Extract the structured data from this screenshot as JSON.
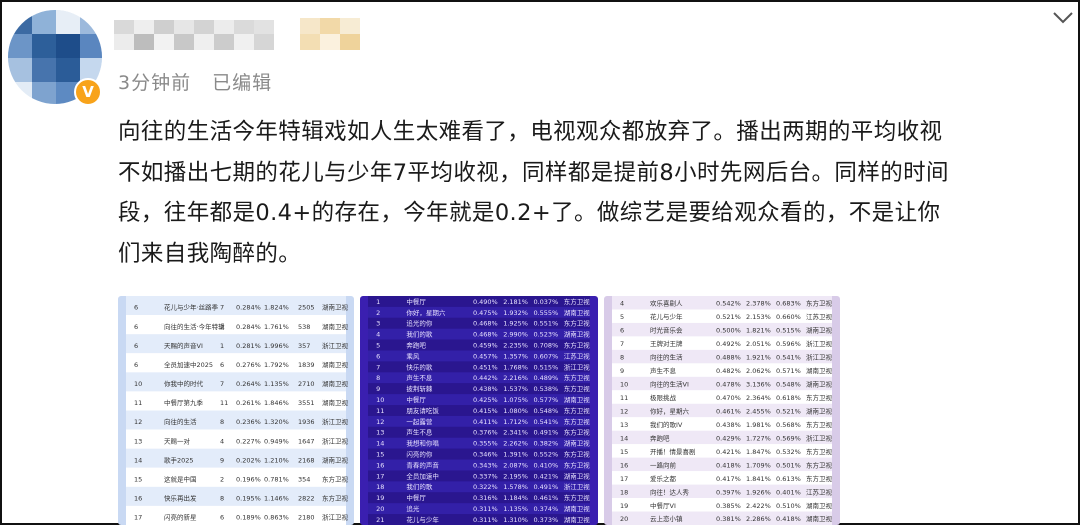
{
  "post": {
    "meta_time": "3分钟前",
    "meta_edited": "已编辑",
    "verified_badge": "V",
    "text_lines": [
      "向往的生活今年特辑戏如人生太难看了，电视观众都放弃了。播出两期的平均收视",
      "不如播出七期的花儿与少年7平均收视，同样都是提前8小时先网后台。同样的时间",
      "段，往年都是0.4+的存在，今年就是0.2+了。做综艺是要给观众看的，不是让你",
      "们来自我陶醉的。"
    ]
  },
  "icons": {
    "avatar": "avatar-image-blurred",
    "verified": "verified-badge-icon",
    "expand": "chevron-down-icon"
  },
  "images": [
    {
      "name": "ratings-table-1",
      "theme": "#c9d9f3",
      "rows": [
        [
          "6",
          "花儿与少年·丝路季",
          "7",
          "0.284%",
          "1.824%",
          "2505",
          "湖南卫视"
        ],
        [
          "6",
          "向往的生活·今年特辑",
          "2",
          "0.284%",
          "1.761%",
          "538",
          "湖南卫视"
        ],
        [
          "6",
          "天赐的声音VI",
          "1",
          "0.281%",
          "1.996%",
          "357",
          "浙江卫视"
        ],
        [
          "6",
          "全员加速中2025",
          "6",
          "0.276%",
          "1.792%",
          "1839",
          "湖南卫视"
        ],
        [
          "10",
          "你我中的时代",
          "7",
          "0.264%",
          "1.135%",
          "2710",
          "湖南卫视"
        ],
        [
          "11",
          "中餐厅第九季",
          "11",
          "0.261%",
          "1.846%",
          "3551",
          "湖南卫视"
        ],
        [
          "12",
          "向往的生活",
          "8",
          "0.236%",
          "1.320%",
          "1936",
          "浙江卫视"
        ],
        [
          "13",
          "天赐一对",
          "4",
          "0.227%",
          "0.949%",
          "1647",
          "浙江卫视"
        ],
        [
          "14",
          "歌手2025",
          "9",
          "0.202%",
          "1.210%",
          "2168",
          "湖南卫视"
        ],
        [
          "15",
          "这就是中国",
          "2",
          "0.196%",
          "0.781%",
          "354",
          "东方卫视"
        ],
        [
          "16",
          "快乐再出发",
          "8",
          "0.195%",
          "1.146%",
          "2822",
          "东方卫视"
        ],
        [
          "17",
          "闪亮的新星",
          "6",
          "0.189%",
          "0.863%",
          "2180",
          "浙江卫视"
        ]
      ]
    },
    {
      "name": "ratings-table-2",
      "theme": "#3a1fb0",
      "rows": [
        [
          "1",
          "中餐厅",
          "0.490%",
          "2.181%",
          "0.037%",
          "东方卫视"
        ],
        [
          "2",
          "你好，星期六",
          "0.475%",
          "1.932%",
          "0.555%",
          "湖南卫视"
        ],
        [
          "3",
          "追光的你",
          "0.468%",
          "1.925%",
          "0.551%",
          "东方卫视"
        ],
        [
          "4",
          "我们的歌",
          "0.468%",
          "2.990%",
          "0.523%",
          "湖南卫视"
        ],
        [
          "5",
          "奔跑吧",
          "0.459%",
          "2.235%",
          "0.708%",
          "东方卫视"
        ],
        [
          "6",
          "乘风",
          "0.457%",
          "1.357%",
          "0.607%",
          "江苏卫视"
        ],
        [
          "7",
          "快乐的歌",
          "0.451%",
          "1.768%",
          "0.515%",
          "浙江卫视"
        ],
        [
          "8",
          "声生不息",
          "0.442%",
          "2.216%",
          "0.489%",
          "东方卫视"
        ],
        [
          "9",
          "披荆斩棘",
          "0.438%",
          "1.537%",
          "0.538%",
          "东方卫视"
        ],
        [
          "10",
          "中餐厅",
          "0.425%",
          "1.075%",
          "0.577%",
          "湖南卫视"
        ],
        [
          "11",
          "朋友请吃饭",
          "0.415%",
          "1.080%",
          "0.548%",
          "东方卫视"
        ],
        [
          "12",
          "一起露营",
          "0.411%",
          "1.712%",
          "0.541%",
          "东方卫视"
        ],
        [
          "13",
          "声生不息",
          "0.376%",
          "2.341%",
          "0.491%",
          "东方卫视"
        ],
        [
          "14",
          "我想和你唱",
          "0.355%",
          "2.262%",
          "0.382%",
          "湖南卫视"
        ],
        [
          "15",
          "闪亮的你",
          "0.346%",
          "1.391%",
          "0.552%",
          "东方卫视"
        ],
        [
          "16",
          "青春的声音",
          "0.343%",
          "2.087%",
          "0.410%",
          "东方卫视"
        ],
        [
          "17",
          "全员加速中",
          "0.337%",
          "2.195%",
          "0.421%",
          "湖南卫视"
        ],
        [
          "18",
          "我们的歌",
          "0.322%",
          "1.578%",
          "0.491%",
          "浙江卫视"
        ],
        [
          "19",
          "中餐厅",
          "0.316%",
          "1.184%",
          "0.461%",
          "东方卫视"
        ],
        [
          "20",
          "追光",
          "0.311%",
          "1.135%",
          "0.374%",
          "湖南卫视"
        ],
        [
          "21",
          "花儿与少年",
          "0.311%",
          "1.310%",
          "0.373%",
          "湖南卫视"
        ]
      ]
    },
    {
      "name": "ratings-table-3",
      "theme": "#d8cbe8",
      "rows": [
        [
          "4",
          "欢乐喜剧人",
          "0.542%",
          "2.378%",
          "0.683%",
          "东方卫视"
        ],
        [
          "5",
          "花儿与少年",
          "0.521%",
          "2.153%",
          "0.660%",
          "江苏卫视"
        ],
        [
          "6",
          "时光音乐会",
          "0.500%",
          "1.821%",
          "0.515%",
          "湖南卫视"
        ],
        [
          "7",
          "王牌对王牌",
          "0.492%",
          "2.051%",
          "0.596%",
          "浙江卫视"
        ],
        [
          "8",
          "向往的生活",
          "0.488%",
          "1.921%",
          "0.541%",
          "浙江卫视"
        ],
        [
          "9",
          "声生不息",
          "0.482%",
          "2.062%",
          "0.571%",
          "湖南卫视"
        ],
        [
          "10",
          "向往的生活VI",
          "0.478%",
          "3.136%",
          "0.548%",
          "湖南卫视"
        ],
        [
          "11",
          "极限挑战",
          "0.470%",
          "2.364%",
          "0.618%",
          "东方卫视"
        ],
        [
          "12",
          "你好，星期六",
          "0.461%",
          "2.455%",
          "0.521%",
          "湖南卫视"
        ],
        [
          "13",
          "我们的歌IV",
          "0.438%",
          "1.981%",
          "0.568%",
          "东方卫视"
        ],
        [
          "14",
          "奔跑吧",
          "0.429%",
          "1.727%",
          "0.569%",
          "浙江卫视"
        ],
        [
          "15",
          "开播！情景喜剧",
          "0.421%",
          "1.847%",
          "0.532%",
          "东方卫视"
        ],
        [
          "16",
          "一路向前",
          "0.418%",
          "1.709%",
          "0.501%",
          "东方卫视"
        ],
        [
          "17",
          "爱乐之都",
          "0.417%",
          "1.841%",
          "0.613%",
          "东方卫视"
        ],
        [
          "18",
          "向往！达人秀",
          "0.397%",
          "1.926%",
          "0.401%",
          "江苏卫视"
        ],
        [
          "19",
          "中餐厅VI",
          "0.385%",
          "2.422%",
          "0.510%",
          "湖南卫视"
        ],
        [
          "20",
          "云上恋小镇",
          "0.381%",
          "2.286%",
          "0.418%",
          "湖南卫视"
        ]
      ]
    }
  ]
}
